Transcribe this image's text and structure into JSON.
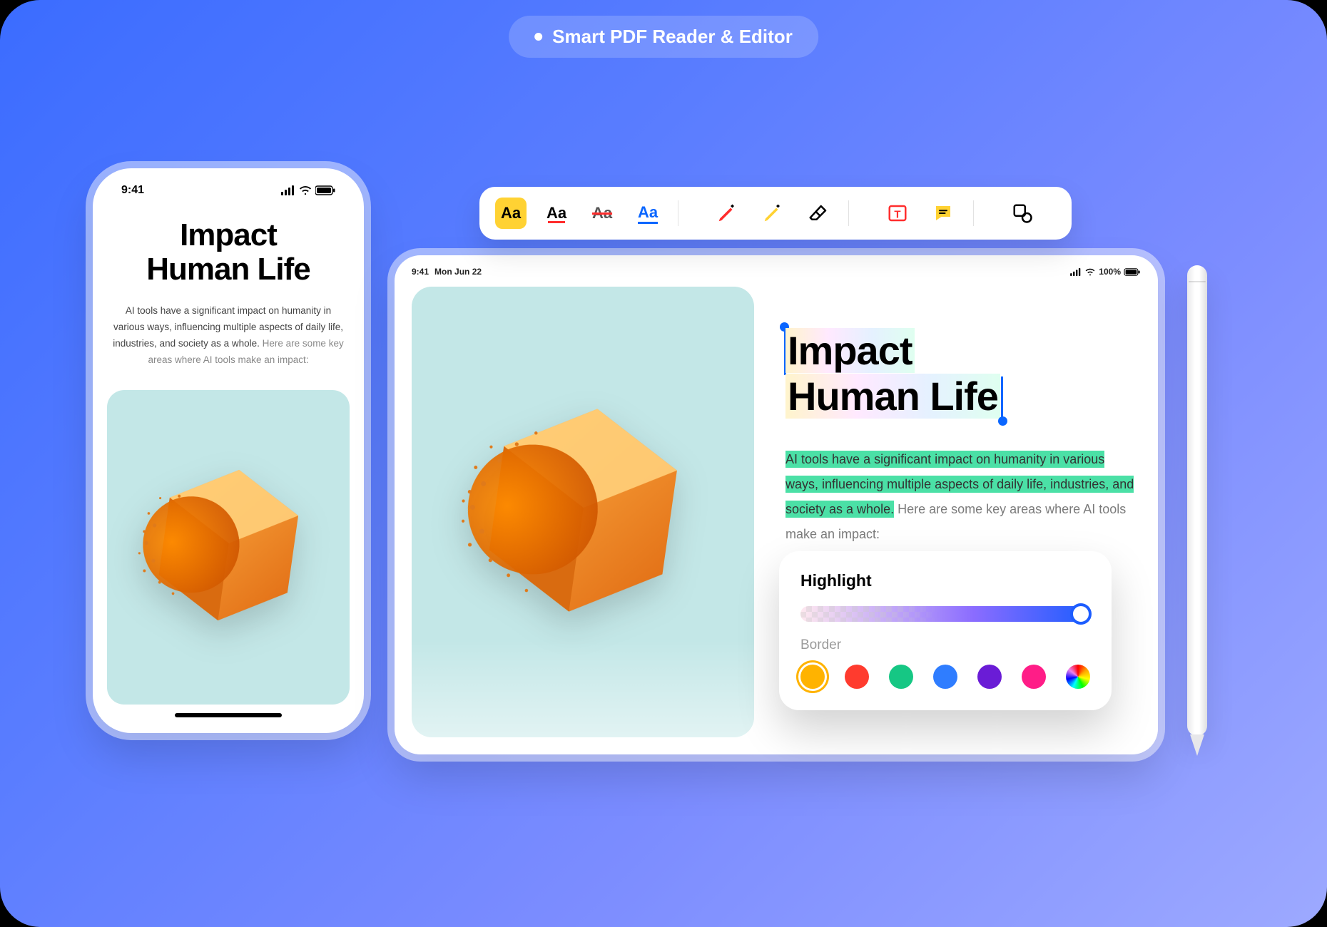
{
  "badge": {
    "label": "Smart PDF Reader & Editor"
  },
  "phone": {
    "time": "9:41",
    "title_line1": "Impact",
    "title_line2": "Human Life",
    "body_highlight": "AI tools have a significant impact on humanity in various ways, influencing multiple aspects of daily life, industries, and society as a whole.",
    "body_rest": " Here are some key areas where AI tools make an impact:"
  },
  "tablet": {
    "time": "9:41",
    "date": "Mon Jun 22",
    "battery": "100%",
    "title_line1": "Impact",
    "title_line2": "Human Life",
    "para_highlight": "AI tools have a significant impact on humanity in various ways, influencing multiple aspects of daily life, industries, and society as a whole.",
    "para_rest": " Here are some key areas where AI tools make an impact:"
  },
  "toolbar": {
    "highlight": "Aa",
    "underline": "Aa",
    "strike": "Aa",
    "link": "Aa"
  },
  "panel": {
    "title": "Highlight",
    "border_label": "Border",
    "colors": [
      "#ffb300",
      "#ff3b2e",
      "#16c784",
      "#2f7dff",
      "#6a1cd6",
      "#ff1d87"
    ]
  }
}
